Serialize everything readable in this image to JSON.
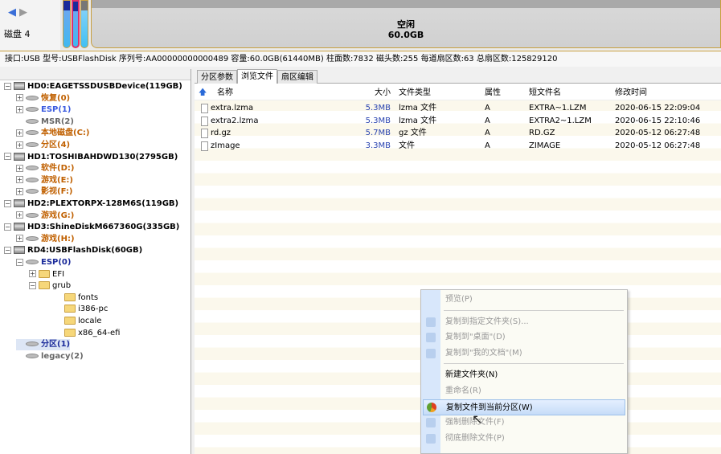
{
  "nav": {
    "back_icon": "arrow-left-icon",
    "forward_icon": "arrow-right-icon",
    "disk_label": "磁盘 4"
  },
  "diskmap": {
    "free_label": "空闲",
    "free_size": "60.0GB"
  },
  "info": "接口:USB  型号:USBFlashDisk  序列号:AA00000000000489  容量:60.0GB(61440MB)  柱面数:7832  磁头数:255  每道扇区数:63  总扇区数:125829120",
  "tree": [
    {
      "label": "HD0:EAGETSSDUSBDevice(119GB)",
      "level": 0,
      "type": "disk",
      "exp": "-",
      "color": "black"
    },
    {
      "label": "恢复(0)",
      "level": 1,
      "type": "part",
      "exp": "+",
      "color": "or"
    },
    {
      "label": "ESP(1)",
      "level": 1,
      "type": "part",
      "exp": "+",
      "color": "bl"
    },
    {
      "label": "MSR(2)",
      "level": 1,
      "type": "part",
      "exp": "",
      "color": "gy"
    },
    {
      "label": "本地磁盘(C:)",
      "level": 1,
      "type": "part",
      "exp": "+",
      "color": "or"
    },
    {
      "label": "分区(4)",
      "level": 1,
      "type": "part",
      "exp": "+",
      "color": "or"
    },
    {
      "label": "HD1:TOSHIBAHDWD130(2795GB)",
      "level": 0,
      "type": "disk",
      "exp": "-",
      "color": "black"
    },
    {
      "label": "软件(D:)",
      "level": 1,
      "type": "part",
      "exp": "+",
      "color": "or"
    },
    {
      "label": "游戏(E:)",
      "level": 1,
      "type": "part",
      "exp": "+",
      "color": "or"
    },
    {
      "label": "影视(F:)",
      "level": 1,
      "type": "part",
      "exp": "+",
      "color": "or"
    },
    {
      "label": "HD2:PLEXTORPX-128M6S(119GB)",
      "level": 0,
      "type": "disk",
      "exp": "-",
      "color": "black"
    },
    {
      "label": "游戏(G:)",
      "level": 1,
      "type": "part",
      "exp": "+",
      "color": "or"
    },
    {
      "label": "HD3:ShineDiskM667360G(335GB)",
      "level": 0,
      "type": "disk",
      "exp": "-",
      "color": "black"
    },
    {
      "label": "游戏(H:)",
      "level": 1,
      "type": "part",
      "exp": "+",
      "color": "or"
    },
    {
      "label": "RD4:USBFlashDisk(60GB)",
      "level": 0,
      "type": "disk",
      "exp": "-",
      "color": "black"
    },
    {
      "label": "ESP(0)",
      "level": 1,
      "type": "part",
      "exp": "-",
      "color": "nv"
    },
    {
      "label": "EFI",
      "level": 2,
      "type": "folder",
      "exp": "+",
      "color": "nm"
    },
    {
      "label": "grub",
      "level": 2,
      "type": "folder",
      "exp": "-",
      "color": "nm"
    },
    {
      "label": "fonts",
      "level": 3,
      "type": "folder",
      "exp": "",
      "color": "nm"
    },
    {
      "label": "i386-pc",
      "level": 3,
      "type": "folder",
      "exp": "",
      "color": "nm"
    },
    {
      "label": "locale",
      "level": 3,
      "type": "folder",
      "exp": "",
      "color": "nm"
    },
    {
      "label": "x86_64-efi",
      "level": 3,
      "type": "folder",
      "exp": "",
      "color": "nm"
    },
    {
      "label": "分区(1)",
      "level": 1,
      "type": "part",
      "exp": "",
      "color": "nv",
      "selected": true
    },
    {
      "label": "legacy(2)",
      "level": 1,
      "type": "part",
      "exp": "",
      "color": "gy"
    }
  ],
  "tabs": [
    {
      "label": "分区参数"
    },
    {
      "label": "浏览文件",
      "active": true
    },
    {
      "label": "扇区编辑"
    }
  ],
  "columns": [
    "名称",
    "大小",
    "文件类型",
    "属性",
    "短文件名",
    "修改时间"
  ],
  "files": [
    [
      "extra.lzma",
      "5.3MB",
      "lzma 文件",
      "A",
      "EXTRA~1.LZM",
      "2020-06-15 22:09:04"
    ],
    [
      "extra2.lzma",
      "5.3MB",
      "lzma 文件",
      "A",
      "EXTRA2~1.LZM",
      "2020-06-15 22:10:46"
    ],
    [
      "rd.gz",
      "5.7MB",
      "gz 文件",
      "A",
      "RD.GZ",
      "2020-05-12 06:27:48"
    ],
    [
      "zImage",
      "3.3MB",
      "文件",
      "A",
      "ZIMAGE",
      "2020-05-12 06:27:48"
    ]
  ],
  "menu": [
    {
      "label": "预览(P)",
      "enabled": false
    },
    {
      "sep": true
    },
    {
      "label": "复制到指定文件夹(S)...",
      "enabled": false,
      "icon": true
    },
    {
      "label": "复制到\"桌面\"(D)",
      "enabled": false,
      "icon": true
    },
    {
      "label": "复制到\"我的文档\"(M)",
      "enabled": false,
      "icon": true
    },
    {
      "sep": true
    },
    {
      "label": "新建文件夹(N)",
      "enabled": true
    },
    {
      "label": "重命名(R)",
      "enabled": false
    },
    {
      "label": "复制文件到当前分区(W)",
      "enabled": true,
      "highlighted": true,
      "icon": true
    },
    {
      "label": "强制删除文件(F)",
      "enabled": false,
      "icon": true
    },
    {
      "label": "彻底删除文件(P)",
      "enabled": false,
      "icon": true
    }
  ]
}
